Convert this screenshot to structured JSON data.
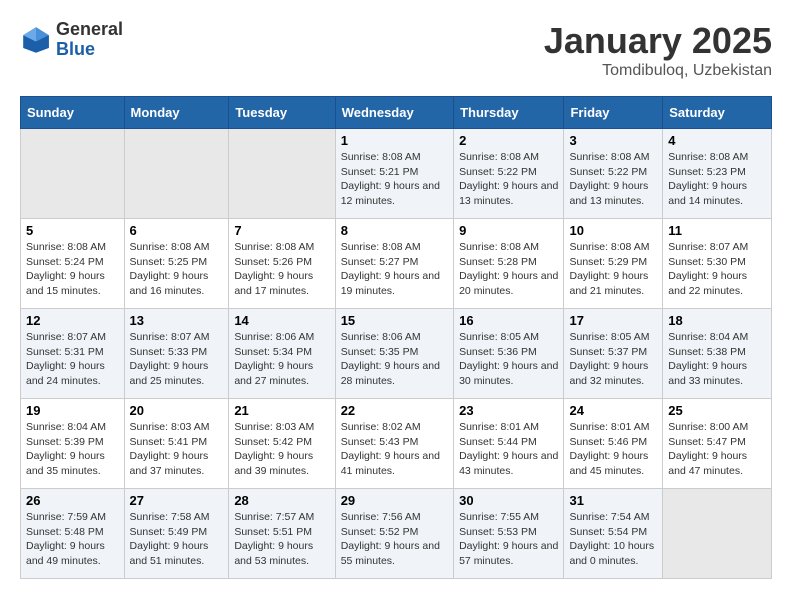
{
  "header": {
    "logo_line1": "General",
    "logo_line2": "Blue",
    "title": "January 2025",
    "subtitle": "Tomdibuloq, Uzbekistan"
  },
  "days_of_week": [
    "Sunday",
    "Monday",
    "Tuesday",
    "Wednesday",
    "Thursday",
    "Friday",
    "Saturday"
  ],
  "weeks": [
    [
      {
        "day": "",
        "sunrise": "",
        "sunset": "",
        "daylight": ""
      },
      {
        "day": "",
        "sunrise": "",
        "sunset": "",
        "daylight": ""
      },
      {
        "day": "",
        "sunrise": "",
        "sunset": "",
        "daylight": ""
      },
      {
        "day": "1",
        "sunrise": "Sunrise: 8:08 AM",
        "sunset": "Sunset: 5:21 PM",
        "daylight": "Daylight: 9 hours and 12 minutes."
      },
      {
        "day": "2",
        "sunrise": "Sunrise: 8:08 AM",
        "sunset": "Sunset: 5:22 PM",
        "daylight": "Daylight: 9 hours and 13 minutes."
      },
      {
        "day": "3",
        "sunrise": "Sunrise: 8:08 AM",
        "sunset": "Sunset: 5:22 PM",
        "daylight": "Daylight: 9 hours and 13 minutes."
      },
      {
        "day": "4",
        "sunrise": "Sunrise: 8:08 AM",
        "sunset": "Sunset: 5:23 PM",
        "daylight": "Daylight: 9 hours and 14 minutes."
      }
    ],
    [
      {
        "day": "5",
        "sunrise": "Sunrise: 8:08 AM",
        "sunset": "Sunset: 5:24 PM",
        "daylight": "Daylight: 9 hours and 15 minutes."
      },
      {
        "day": "6",
        "sunrise": "Sunrise: 8:08 AM",
        "sunset": "Sunset: 5:25 PM",
        "daylight": "Daylight: 9 hours and 16 minutes."
      },
      {
        "day": "7",
        "sunrise": "Sunrise: 8:08 AM",
        "sunset": "Sunset: 5:26 PM",
        "daylight": "Daylight: 9 hours and 17 minutes."
      },
      {
        "day": "8",
        "sunrise": "Sunrise: 8:08 AM",
        "sunset": "Sunset: 5:27 PM",
        "daylight": "Daylight: 9 hours and 19 minutes."
      },
      {
        "day": "9",
        "sunrise": "Sunrise: 8:08 AM",
        "sunset": "Sunset: 5:28 PM",
        "daylight": "Daylight: 9 hours and 20 minutes."
      },
      {
        "day": "10",
        "sunrise": "Sunrise: 8:08 AM",
        "sunset": "Sunset: 5:29 PM",
        "daylight": "Daylight: 9 hours and 21 minutes."
      },
      {
        "day": "11",
        "sunrise": "Sunrise: 8:07 AM",
        "sunset": "Sunset: 5:30 PM",
        "daylight": "Daylight: 9 hours and 22 minutes."
      }
    ],
    [
      {
        "day": "12",
        "sunrise": "Sunrise: 8:07 AM",
        "sunset": "Sunset: 5:31 PM",
        "daylight": "Daylight: 9 hours and 24 minutes."
      },
      {
        "day": "13",
        "sunrise": "Sunrise: 8:07 AM",
        "sunset": "Sunset: 5:33 PM",
        "daylight": "Daylight: 9 hours and 25 minutes."
      },
      {
        "day": "14",
        "sunrise": "Sunrise: 8:06 AM",
        "sunset": "Sunset: 5:34 PM",
        "daylight": "Daylight: 9 hours and 27 minutes."
      },
      {
        "day": "15",
        "sunrise": "Sunrise: 8:06 AM",
        "sunset": "Sunset: 5:35 PM",
        "daylight": "Daylight: 9 hours and 28 minutes."
      },
      {
        "day": "16",
        "sunrise": "Sunrise: 8:05 AM",
        "sunset": "Sunset: 5:36 PM",
        "daylight": "Daylight: 9 hours and 30 minutes."
      },
      {
        "day": "17",
        "sunrise": "Sunrise: 8:05 AM",
        "sunset": "Sunset: 5:37 PM",
        "daylight": "Daylight: 9 hours and 32 minutes."
      },
      {
        "day": "18",
        "sunrise": "Sunrise: 8:04 AM",
        "sunset": "Sunset: 5:38 PM",
        "daylight": "Daylight: 9 hours and 33 minutes."
      }
    ],
    [
      {
        "day": "19",
        "sunrise": "Sunrise: 8:04 AM",
        "sunset": "Sunset: 5:39 PM",
        "daylight": "Daylight: 9 hours and 35 minutes."
      },
      {
        "day": "20",
        "sunrise": "Sunrise: 8:03 AM",
        "sunset": "Sunset: 5:41 PM",
        "daylight": "Daylight: 9 hours and 37 minutes."
      },
      {
        "day": "21",
        "sunrise": "Sunrise: 8:03 AM",
        "sunset": "Sunset: 5:42 PM",
        "daylight": "Daylight: 9 hours and 39 minutes."
      },
      {
        "day": "22",
        "sunrise": "Sunrise: 8:02 AM",
        "sunset": "Sunset: 5:43 PM",
        "daylight": "Daylight: 9 hours and 41 minutes."
      },
      {
        "day": "23",
        "sunrise": "Sunrise: 8:01 AM",
        "sunset": "Sunset: 5:44 PM",
        "daylight": "Daylight: 9 hours and 43 minutes."
      },
      {
        "day": "24",
        "sunrise": "Sunrise: 8:01 AM",
        "sunset": "Sunset: 5:46 PM",
        "daylight": "Daylight: 9 hours and 45 minutes."
      },
      {
        "day": "25",
        "sunrise": "Sunrise: 8:00 AM",
        "sunset": "Sunset: 5:47 PM",
        "daylight": "Daylight: 9 hours and 47 minutes."
      }
    ],
    [
      {
        "day": "26",
        "sunrise": "Sunrise: 7:59 AM",
        "sunset": "Sunset: 5:48 PM",
        "daylight": "Daylight: 9 hours and 49 minutes."
      },
      {
        "day": "27",
        "sunrise": "Sunrise: 7:58 AM",
        "sunset": "Sunset: 5:49 PM",
        "daylight": "Daylight: 9 hours and 51 minutes."
      },
      {
        "day": "28",
        "sunrise": "Sunrise: 7:57 AM",
        "sunset": "Sunset: 5:51 PM",
        "daylight": "Daylight: 9 hours and 53 minutes."
      },
      {
        "day": "29",
        "sunrise": "Sunrise: 7:56 AM",
        "sunset": "Sunset: 5:52 PM",
        "daylight": "Daylight: 9 hours and 55 minutes."
      },
      {
        "day": "30",
        "sunrise": "Sunrise: 7:55 AM",
        "sunset": "Sunset: 5:53 PM",
        "daylight": "Daylight: 9 hours and 57 minutes."
      },
      {
        "day": "31",
        "sunrise": "Sunrise: 7:54 AM",
        "sunset": "Sunset: 5:54 PM",
        "daylight": "Daylight: 10 hours and 0 minutes."
      },
      {
        "day": "",
        "sunrise": "",
        "sunset": "",
        "daylight": ""
      }
    ]
  ]
}
